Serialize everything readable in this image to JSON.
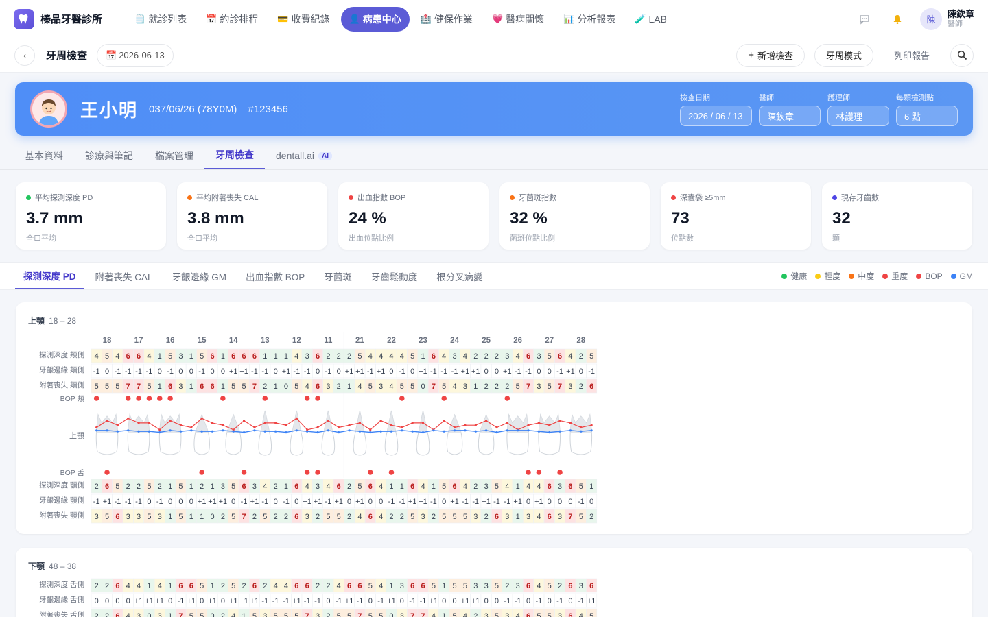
{
  "brand": {
    "name": "榛品牙醫診所",
    "logo_icon": "tooth-icon"
  },
  "nav": [
    {
      "label": "就診列表",
      "icon": "list-icon",
      "glyph": "🗒️",
      "active": false
    },
    {
      "label": "約診排程",
      "icon": "calendar-icon",
      "glyph": "📅",
      "active": false
    },
    {
      "label": "收費紀錄",
      "icon": "card-icon",
      "glyph": "💳",
      "active": false
    },
    {
      "label": "病患中心",
      "icon": "person-icon",
      "glyph": "👤",
      "active": true
    },
    {
      "label": "健保作業",
      "icon": "hospital-icon",
      "glyph": "🏥",
      "active": false
    },
    {
      "label": "醫病關懷",
      "icon": "heart-icon",
      "glyph": "💗",
      "active": false
    },
    {
      "label": "分析報表",
      "icon": "chart-icon",
      "glyph": "📊",
      "active": false
    },
    {
      "label": "LAB",
      "icon": "test-tube-icon",
      "glyph": "🧪",
      "active": false
    }
  ],
  "user": {
    "avatar": "陳",
    "name": "陳欽章",
    "role": "醫師"
  },
  "subbar": {
    "title": "牙周檢查",
    "date": "2026-06-13",
    "actions": {
      "add": "新增檢查",
      "mode": "牙周模式",
      "print": "列印報告"
    }
  },
  "patient": {
    "name": "王小明",
    "dob_age": "037/06/26 (78Y0M)",
    "id": "#123456",
    "fields": [
      {
        "label": "檢查日期",
        "value": "2026 / 06 / 13"
      },
      {
        "label": "醫師",
        "value": "陳欽章"
      },
      {
        "label": "護理師",
        "value": "林護理"
      },
      {
        "label": "每顆檢測點",
        "value": "6 點"
      }
    ]
  },
  "tabs": [
    {
      "label": "基本資料",
      "active": false
    },
    {
      "label": "診療與筆記",
      "active": false
    },
    {
      "label": "檔案管理",
      "active": false
    },
    {
      "label": "牙周檢查",
      "active": true
    },
    {
      "label": "dentall.ai",
      "active": false,
      "badge": "AI"
    }
  ],
  "stats": [
    {
      "label": "平均探測深度 PD",
      "value": "3.7 mm",
      "sub": "全口平均",
      "color": "#22c55e"
    },
    {
      "label": "平均附著喪失 CAL",
      "value": "3.8 mm",
      "sub": "全口平均",
      "color": "#f97316"
    },
    {
      "label": "出血指數 BOP",
      "value": "24 %",
      "sub": "出血位點比例",
      "color": "#ef4444"
    },
    {
      "label": "牙菌斑指數",
      "value": "32 %",
      "sub": "菌斑位點比例",
      "color": "#f97316"
    },
    {
      "label": "深囊袋 ≥5mm",
      "value": "73",
      "sub": "位點數",
      "color": "#ef4444"
    },
    {
      "label": "現存牙齒數",
      "value": "32",
      "sub": "顆",
      "color": "#4f46e5"
    }
  ],
  "metric_tabs": [
    {
      "label": "探測深度 PD",
      "active": true
    },
    {
      "label": "附著喪失 CAL",
      "active": false
    },
    {
      "label": "牙齦邊緣 GM",
      "active": false
    },
    {
      "label": "出血指數 BOP",
      "active": false
    },
    {
      "label": "牙菌斑",
      "active": false
    },
    {
      "label": "牙齒鬆動度",
      "active": false
    },
    {
      "label": "根分叉病變",
      "active": false
    }
  ],
  "legend": [
    {
      "label": "健康",
      "color": "#22c55e"
    },
    {
      "label": "輕度",
      "color": "#facc15"
    },
    {
      "label": "中度",
      "color": "#f97316"
    },
    {
      "label": "重度",
      "color": "#ef4444"
    },
    {
      "label": "BOP",
      "color": "#ef4444"
    },
    {
      "label": "GM",
      "color": "#3b82f6"
    }
  ],
  "upper": {
    "title": "上顎",
    "range": "18 – 28",
    "teeth": [
      "18",
      "17",
      "16",
      "15",
      "14",
      "13",
      "12",
      "11",
      "21",
      "22",
      "23",
      "24",
      "25",
      "26",
      "27",
      "28"
    ],
    "row_labels": {
      "pd_b": "探測深度 頰側",
      "gm_b": "牙齦邊緣 頰側",
      "cal_b": "附著喪失 頰側",
      "bop_b": "BOP 頰",
      "jaw": "上顎",
      "bop_l": "BOP 舌",
      "pd_p": "探測深度 顎側",
      "gm_p": "牙齦邊緣 顎側",
      "cal_p": "附著喪失 顎側"
    },
    "pd_b": [
      4,
      5,
      4,
      6,
      6,
      4,
      1,
      5,
      3,
      1,
      5,
      6,
      1,
      6,
      6,
      6,
      1,
      1,
      1,
      4,
      3,
      6,
      2,
      2,
      2,
      5,
      4,
      4,
      4,
      4,
      5,
      1,
      6,
      4,
      3,
      4,
      2,
      2,
      2,
      3,
      4,
      6,
      3,
      5,
      6,
      4,
      2,
      5
    ],
    "gm_b": [
      "-1",
      "0",
      "-1",
      "-1",
      "-1",
      "-1",
      "0",
      "-1",
      "0",
      "0",
      "-1",
      "0",
      "0",
      "+1",
      "+1",
      "-1",
      "-1",
      "0",
      "+1",
      "-1",
      "-1",
      "0",
      "-1",
      "0",
      "+1",
      "+1",
      "-1",
      "+1",
      "0",
      "-1",
      "0",
      "+1",
      "-1",
      "-1",
      "-1",
      "+1",
      "+1",
      "0",
      "0",
      "+1",
      "-1",
      "-1",
      "0",
      "0",
      "-1",
      "+1",
      "0",
      "-1"
    ],
    "cal_b": [
      5,
      5,
      5,
      7,
      7,
      5,
      1,
      6,
      3,
      1,
      6,
      6,
      1,
      5,
      5,
      7,
      2,
      1,
      0,
      5,
      4,
      6,
      3,
      2,
      1,
      4,
      5,
      3,
      4,
      5,
      5,
      0,
      7,
      5,
      4,
      3,
      1,
      2,
      2,
      2,
      5,
      7,
      3,
      5,
      7,
      3,
      2,
      6
    ],
    "bop_b": [
      0,
      3,
      4,
      5,
      6,
      7,
      12,
      16,
      20,
      21,
      29,
      33,
      39
    ],
    "bop_l": [
      1,
      10,
      14,
      20,
      21,
      26,
      28,
      41,
      42,
      44
    ],
    "pd_p": [
      2,
      6,
      5,
      2,
      2,
      5,
      2,
      1,
      5,
      1,
      2,
      1,
      3,
      5,
      6,
      3,
      4,
      2,
      1,
      6,
      4,
      3,
      4,
      6,
      2,
      5,
      6,
      4,
      1,
      1,
      6,
      4,
      1,
      5,
      6,
      4,
      2,
      3,
      5,
      4,
      1,
      4,
      4,
      6,
      3,
      6,
      5,
      1
    ],
    "gm_p": [
      "-1",
      "+1",
      "-1",
      "-1",
      "-1",
      "0",
      "-1",
      "0",
      "0",
      "0",
      "+1",
      "+1",
      "+1",
      "0",
      "-1",
      "+1",
      "-1",
      "0",
      "-1",
      "0",
      "+1",
      "+1",
      "-1",
      "+1",
      "0",
      "+1",
      "0",
      "0",
      "-1",
      "-1",
      "+1",
      "+1",
      "-1",
      "0",
      "+1",
      "-1",
      "-1",
      "+1",
      "-1",
      "-1",
      "+1",
      "0",
      "+1",
      "0",
      "0",
      "0",
      "-1",
      "0"
    ],
    "cal_p": [
      3,
      5,
      6,
      3,
      3,
      5,
      3,
      1,
      5,
      1,
      1,
      0,
      2,
      5,
      7,
      2,
      5,
      2,
      2,
      6,
      3,
      2,
      5,
      5,
      2,
      4,
      6,
      4,
      2,
      2,
      5,
      3,
      2,
      5,
      5,
      5,
      3,
      2,
      6,
      3,
      1,
      3,
      4,
      6,
      3,
      7,
      5,
      2
    ],
    "gm_line": [
      5,
      2,
      4,
      1,
      3,
      3,
      6,
      2,
      4,
      5,
      1,
      3,
      4,
      6,
      2,
      5,
      3,
      3,
      4,
      1,
      6,
      5,
      2,
      5,
      4,
      3,
      6,
      2,
      4,
      5,
      3,
      3,
      6,
      2,
      5,
      4,
      4,
      2,
      5,
      3,
      6,
      4,
      3,
      4,
      2,
      3,
      5,
      4
    ],
    "gm_line_low": [
      2,
      2,
      3,
      2,
      3,
      3,
      4,
      2,
      3,
      2,
      3,
      3,
      2,
      3,
      4,
      2,
      3,
      3,
      4,
      2,
      3,
      4,
      2,
      4,
      2,
      3,
      4,
      3,
      3,
      2,
      3,
      4,
      2,
      3,
      2,
      2,
      3,
      2,
      4,
      2,
      2,
      2,
      3,
      4,
      3,
      2,
      3,
      2
    ]
  },
  "lower": {
    "title": "下顎",
    "range": "48 – 38",
    "row_labels": {
      "pd_l": "探測深度 舌側",
      "gm_l": "牙齦邊緣 舌側",
      "cal_l": "附著喪失 舌側"
    },
    "pd_l": [
      2,
      2,
      6,
      4,
      4,
      1,
      4,
      1,
      6,
      6,
      5,
      1,
      2,
      5,
      2,
      6,
      2,
      4,
      4,
      6,
      6,
      2,
      2,
      4,
      6,
      6,
      5,
      4,
      1,
      3,
      6,
      6,
      5,
      1,
      5,
      5,
      3,
      3,
      5,
      2,
      3,
      6,
      4,
      5,
      2,
      6,
      3,
      6
    ],
    "gm_l": [
      "0",
      "0",
      "0",
      "0",
      "+1",
      "+1",
      "+1",
      "0",
      "-1",
      "+1",
      "0",
      "+1",
      "0",
      "+1",
      "+1",
      "+1",
      "-1",
      "-1",
      "-1",
      "+1",
      "-1",
      "-1",
      "0",
      "-1",
      "+1",
      "-1",
      "0",
      "-1",
      "+1",
      "0",
      "-1",
      "-1",
      "+1",
      "0",
      "0",
      "+1",
      "+1",
      "0",
      "0",
      "-1",
      "-1",
      "0",
      "-1",
      "0",
      "-1",
      "0",
      "-1",
      "+1"
    ],
    "cal_l": [
      2,
      2,
      6,
      4,
      3,
      0,
      3,
      1,
      7,
      5,
      5,
      0,
      2,
      4,
      1,
      5,
      3,
      5,
      5,
      5,
      7,
      3,
      2,
      5,
      5,
      7,
      5,
      5,
      0,
      3,
      7,
      7,
      4,
      1,
      5,
      4,
      2,
      3,
      5,
      3,
      4,
      6,
      5,
      5,
      3,
      6,
      4,
      5
    ]
  }
}
